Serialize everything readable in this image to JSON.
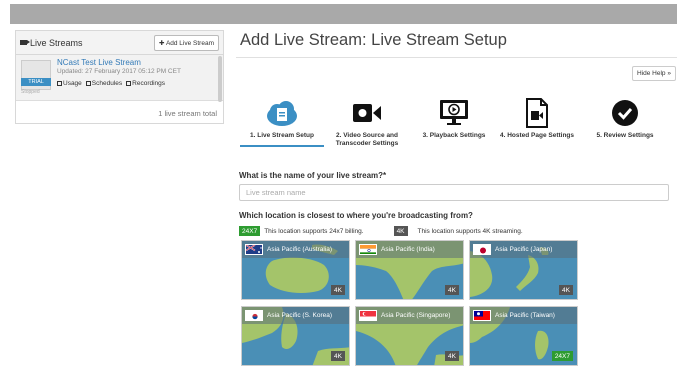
{
  "left_panel": {
    "title": "Live Streams",
    "add_button": "Add Live Stream",
    "stream": {
      "name": "NCast Test Live Stream",
      "updated": "Updated: 27 February 2017 05:12 PM CET",
      "badge": "TRIAL",
      "status": "Stopped",
      "links": [
        "Usage",
        "Schedules",
        "Recordings"
      ]
    },
    "total": "1 live stream total"
  },
  "main": {
    "title": "Add Live Stream: Live Stream Setup",
    "hide_help": "Hide Help »",
    "steps": [
      {
        "label": "1. Live Stream Setup",
        "icon": "cloud-upload-icon"
      },
      {
        "label": "2. Video Source and Transcoder Settings",
        "icon": "video-camera-icon"
      },
      {
        "label": "3. Playback Settings",
        "icon": "monitor-play-icon"
      },
      {
        "label": "4. Hosted Page Settings",
        "icon": "document-video-icon"
      },
      {
        "label": "5. Review Settings",
        "icon": "check-circle-icon"
      }
    ],
    "question_name": "What is the name of your live stream?*",
    "name_placeholder": "Live stream name",
    "question_location": "Which location is closest to where you're broadcasting from?",
    "legend": {
      "badge_24x7": "24X7",
      "text_24x7": "This location supports 24x7 billing.",
      "badge_4k": "4K",
      "text_4k": "This location supports 4K streaming."
    },
    "locations": [
      {
        "label": "Asia Pacific (Australia)",
        "badge": "4K"
      },
      {
        "label": "Asia Pacific (India)",
        "badge": "4K"
      },
      {
        "label": "Asia Pacific (Japan)",
        "badge": "4K"
      },
      {
        "label": "Asia Pacific (S. Korea)",
        "badge": "4K"
      },
      {
        "label": "Asia Pacific (Singapore)",
        "badge": "4K"
      },
      {
        "label": "Asia Pacific (Taiwan)",
        "badge": "24X7"
      }
    ]
  },
  "colors": {
    "accent": "#3b8fc4",
    "green": "#2e9c31",
    "dark_badge": "#555555",
    "sea": "#4a8fb6",
    "land": "#a4c46a"
  }
}
